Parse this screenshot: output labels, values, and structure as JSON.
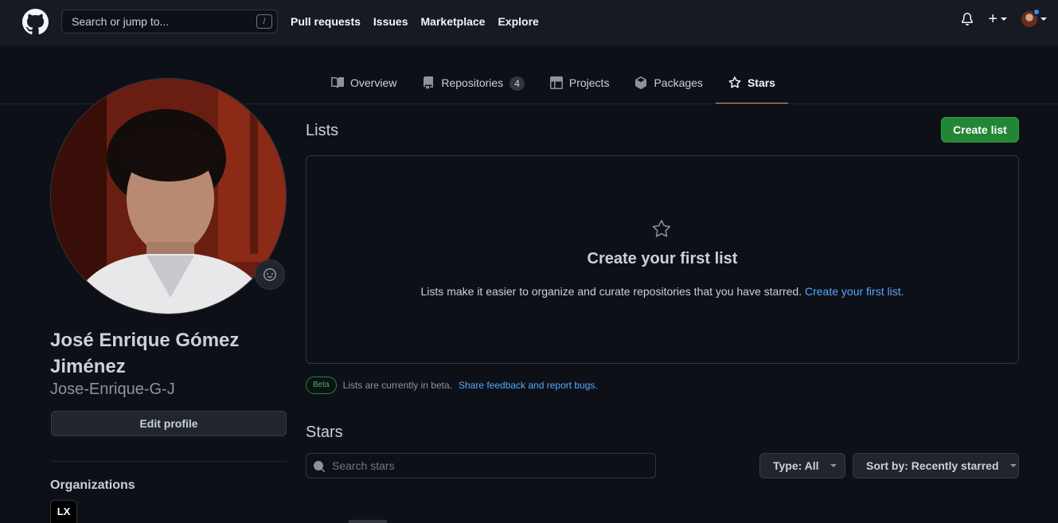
{
  "header": {
    "search_placeholder": "Search or jump to...",
    "search_shortcut": "/",
    "nav": [
      "Pull requests",
      "Issues",
      "Marketplace",
      "Explore"
    ],
    "plus": "+"
  },
  "tabs": [
    {
      "label": "Overview",
      "icon": "book-icon"
    },
    {
      "label": "Repositories",
      "icon": "repo-icon",
      "count": "4"
    },
    {
      "label": "Projects",
      "icon": "project-icon"
    },
    {
      "label": "Packages",
      "icon": "package-icon"
    },
    {
      "label": "Stars",
      "icon": "star-icon",
      "active": true
    }
  ],
  "profile": {
    "full_name": "José Enrique Gómez Jiménez",
    "username": "Jose-Enrique-G-J",
    "edit_label": "Edit profile",
    "organizations_title": "Organizations",
    "org_logo_text": "LX"
  },
  "lists": {
    "title": "Lists",
    "create_label": "Create list",
    "blank_title": "Create your first list",
    "blank_text": "Lists make it easier to organize and curate repositories that you have starred.",
    "blank_link": "Create your first list."
  },
  "beta": {
    "badge": "Beta",
    "text": "Lists are currently in beta.",
    "link": "Share feedback and report bugs."
  },
  "stars": {
    "title": "Stars",
    "search_placeholder": "Search stars",
    "type_label": "Type: All",
    "sort_label": "Sort by: Recently starred"
  },
  "colors": {
    "background": "#0d1117",
    "header": "#161b22",
    "accent_green": "#238636",
    "link_blue": "#58a6ff",
    "active_tab_underline": "#f78166"
  }
}
